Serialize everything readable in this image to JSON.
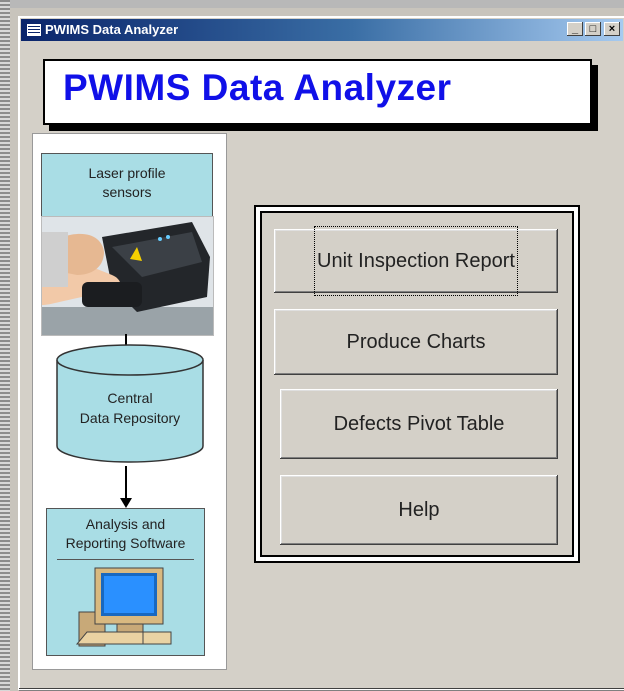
{
  "window": {
    "title": "PWIMS Data Analyzer"
  },
  "banner": {
    "text": "PWIMS Data Analyzer"
  },
  "diagram": {
    "sensor_label": [
      "Laser profile",
      "sensors"
    ],
    "repository_label": [
      "Central",
      "Data Repository"
    ],
    "software_label": [
      "Analysis and",
      "Reporting Software"
    ]
  },
  "menu": {
    "buttons": [
      {
        "label": "Unit Inspection Report"
      },
      {
        "label": "Produce Charts"
      },
      {
        "label": "Defects Pivot Table"
      },
      {
        "label": "Help"
      }
    ]
  },
  "colors": {
    "title_blue": "#1010e8",
    "diagram_cyan": "#a9dde5",
    "titlebar": "#0a246a"
  }
}
